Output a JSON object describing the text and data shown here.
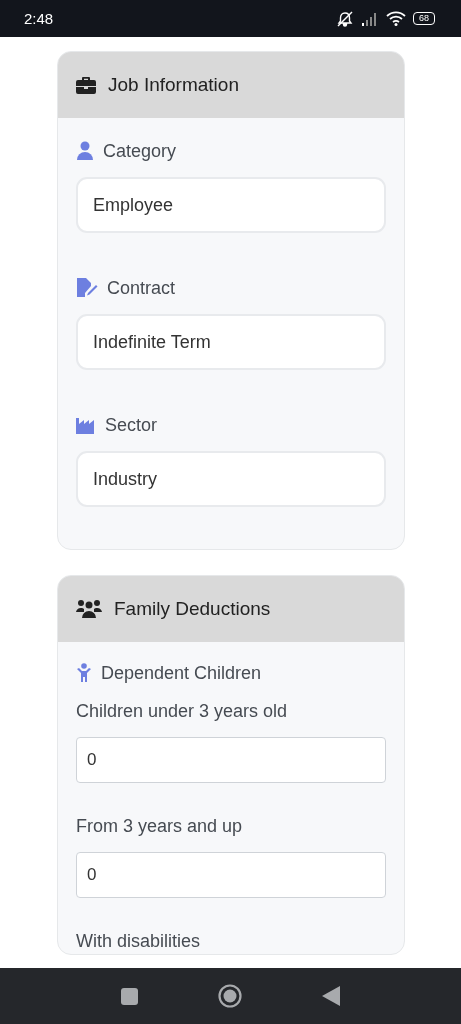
{
  "status_bar": {
    "time": "2:48",
    "battery": "68"
  },
  "sections": [
    {
      "title": "Job Information",
      "fields": [
        {
          "kind": "select",
          "label": "Category",
          "value": "Employee"
        },
        {
          "kind": "select",
          "label": "Contract",
          "value": "Indefinite Term"
        },
        {
          "kind": "select",
          "label": "Sector",
          "value": "Industry"
        }
      ]
    },
    {
      "title": "Family Deductions",
      "subheading": "Dependent Children",
      "fields": [
        {
          "kind": "number",
          "label": "Children under 3 years old",
          "value": "0"
        },
        {
          "kind": "number",
          "label": "From 3 years and up",
          "value": "0"
        },
        {
          "kind": "number",
          "label": "With disabilities"
        }
      ]
    }
  ]
}
